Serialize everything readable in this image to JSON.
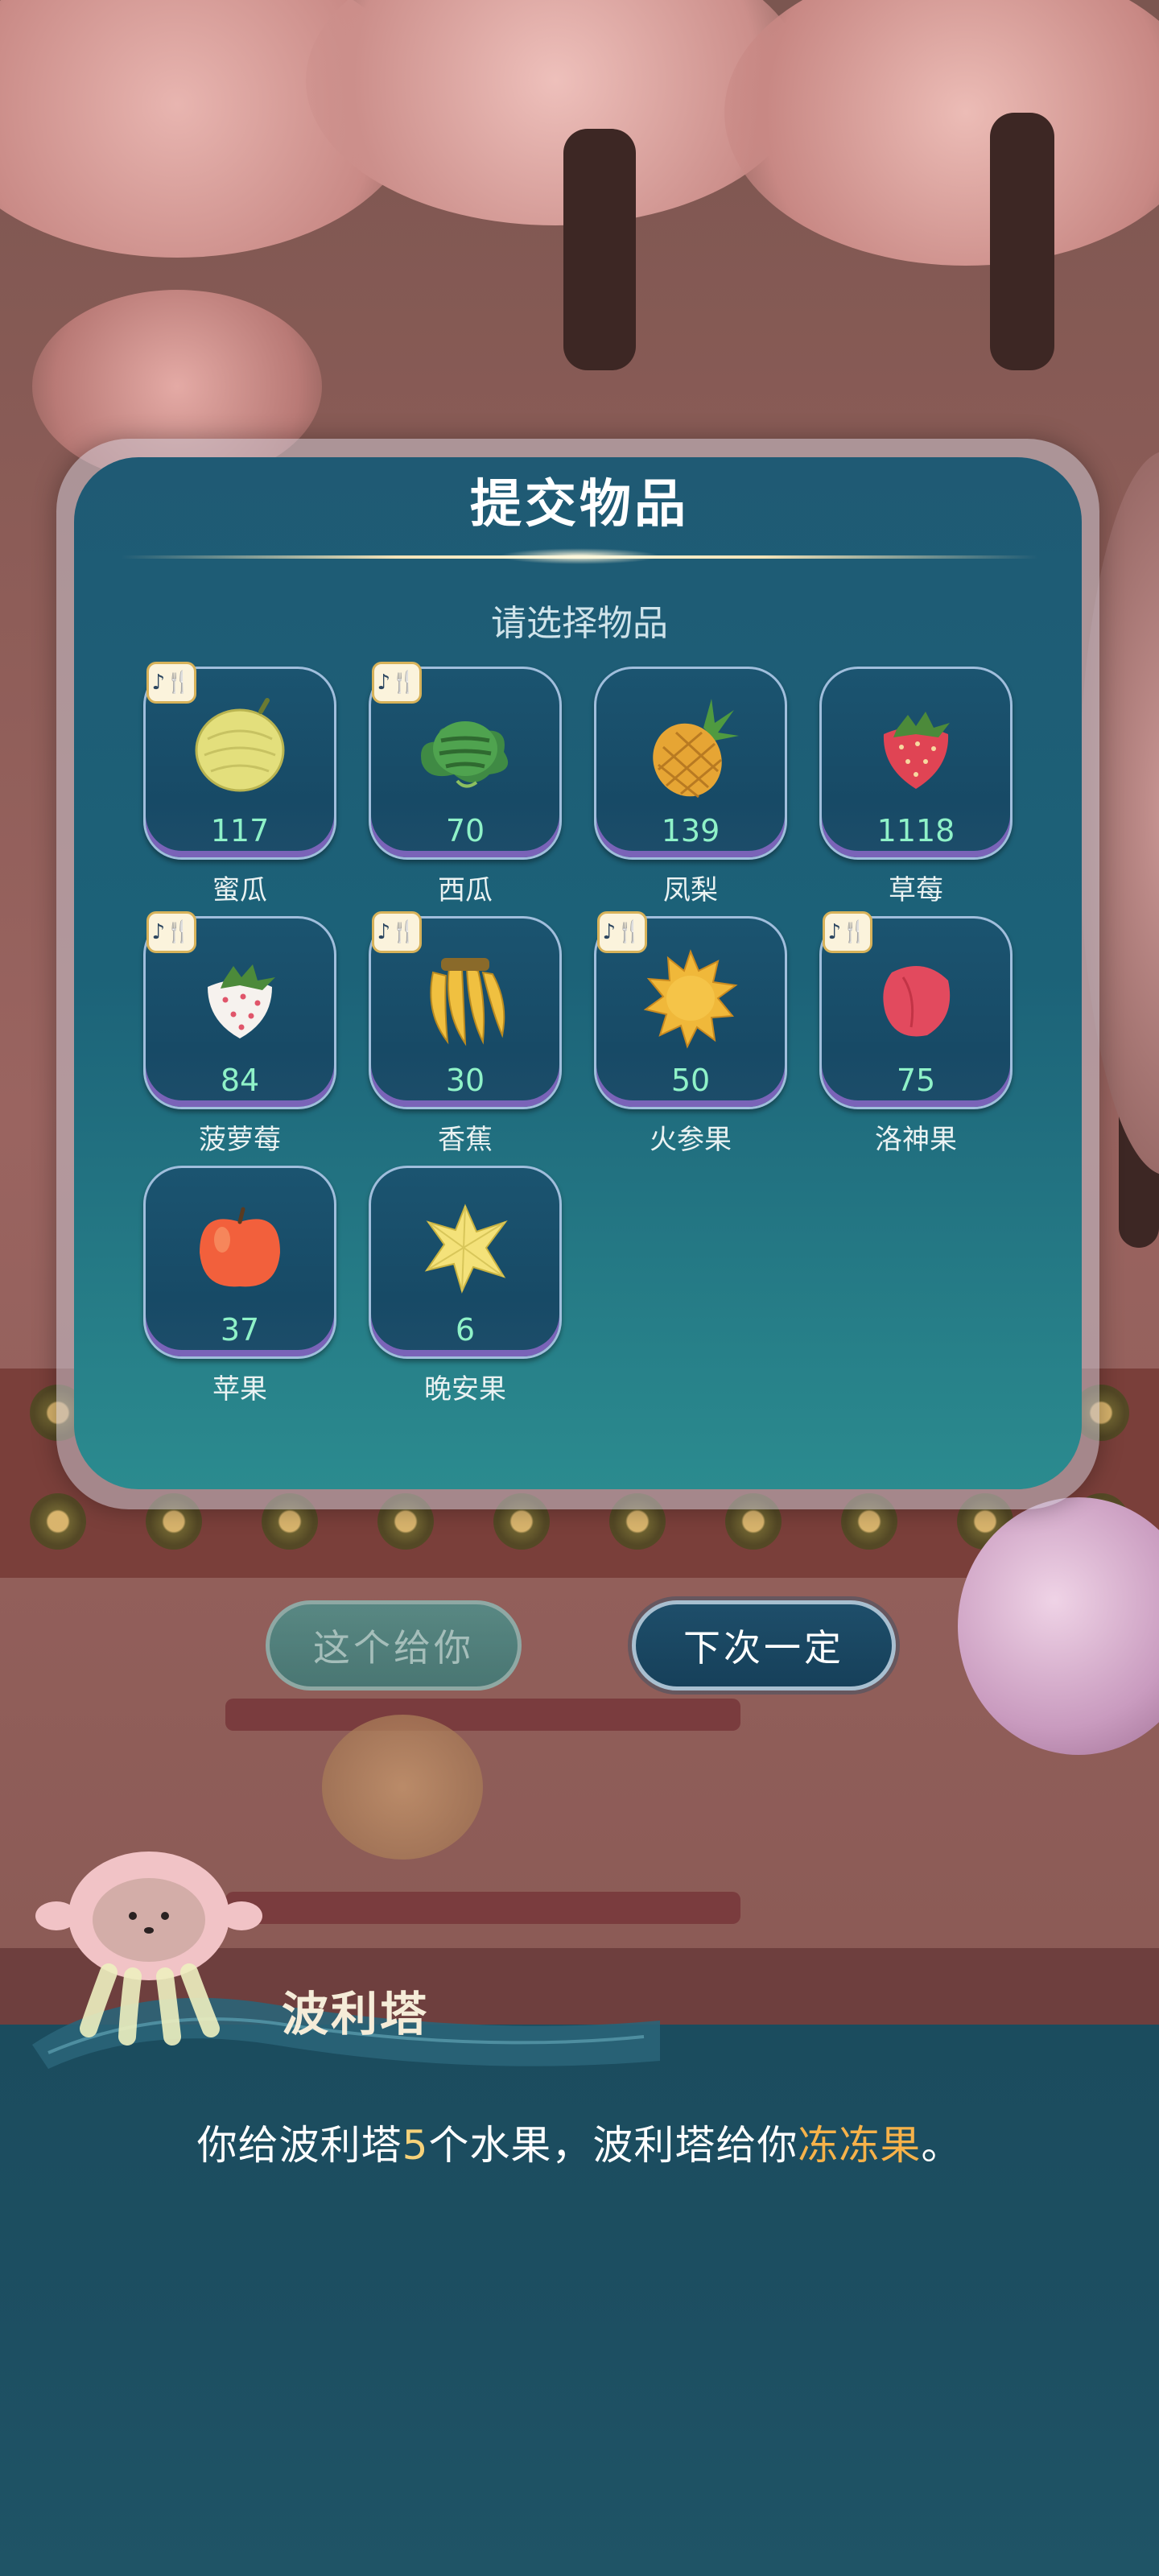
{
  "dialog": {
    "title": "提交物品",
    "subtitle": "请选择物品",
    "badge_icon": "music-note-icon",
    "items": [
      {
        "name": "蜜瓜",
        "count": "117",
        "icon": "melon-icon",
        "badge": true
      },
      {
        "name": "西瓜",
        "count": "70",
        "icon": "watermelon-icon",
        "badge": true
      },
      {
        "name": "凤梨",
        "count": "139",
        "icon": "pineapple-icon",
        "badge": false
      },
      {
        "name": "草莓",
        "count": "1118",
        "icon": "strawberry-icon",
        "badge": false
      },
      {
        "name": "菠萝莓",
        "count": "84",
        "icon": "white-strawberry-icon",
        "badge": true
      },
      {
        "name": "香蕉",
        "count": "30",
        "icon": "banana-icon",
        "badge": true
      },
      {
        "name": "火参果",
        "count": "50",
        "icon": "kiwano-icon",
        "badge": true
      },
      {
        "name": "洛神果",
        "count": "75",
        "icon": "roselle-icon",
        "badge": true
      },
      {
        "name": "苹果",
        "count": "37",
        "icon": "apple-icon",
        "badge": false
      },
      {
        "name": "晚安果",
        "count": "6",
        "icon": "star-fruit-icon",
        "badge": false
      }
    ]
  },
  "buttons": {
    "give_label": "这个给你",
    "next_label": "下次一定"
  },
  "npc": {
    "name": "波利塔",
    "speech_prefix": "你给波利塔",
    "speech_number": "5",
    "speech_middle": "个水果，波利塔给你",
    "speech_highlight": "冻冻果",
    "speech_suffix": "。"
  },
  "colors": {
    "count_text": "#8ff2c8",
    "highlight": "#f6b24a",
    "panel": "#1c6278"
  }
}
